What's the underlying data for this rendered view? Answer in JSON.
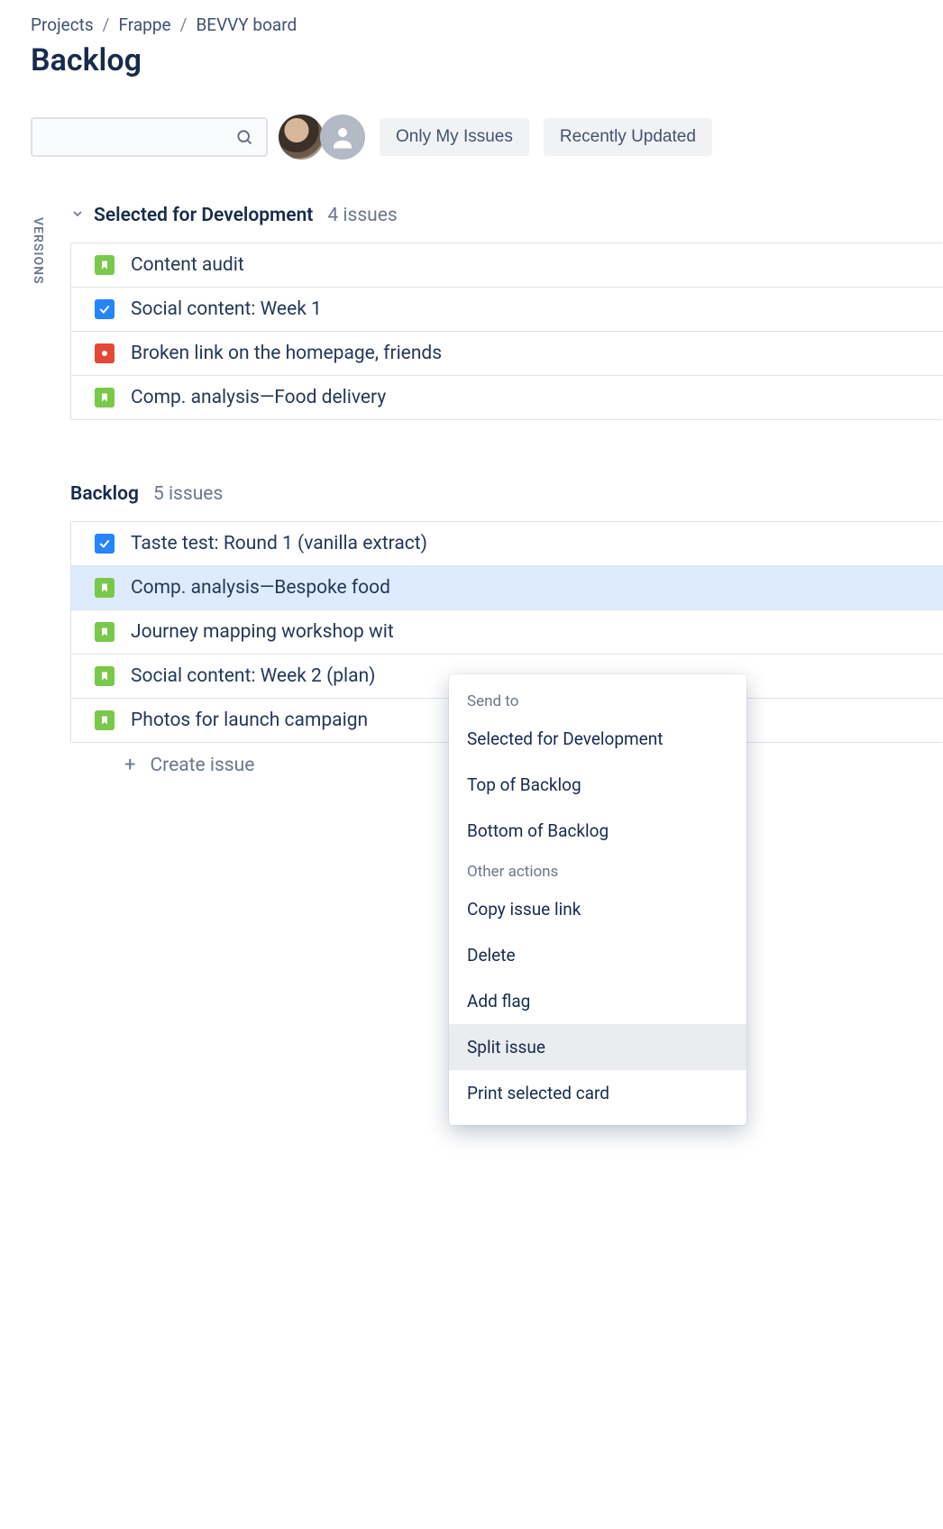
{
  "breadcrumb": {
    "item0": "Projects",
    "item1": "Frappe",
    "item2": "BEVVY board"
  },
  "page_title": "Backlog",
  "toolbar": {
    "only_my_issues": "Only My Issues",
    "recently_updated": "Recently Updated"
  },
  "versions_label": "VERSIONS",
  "sections": {
    "selected": {
      "title": "Selected for Development",
      "count_label": "4 issues"
    },
    "backlog": {
      "title": "Backlog",
      "count_label": "5 issues"
    }
  },
  "selected_issues": [
    {
      "type": "story",
      "title": "Content audit"
    },
    {
      "type": "task",
      "title": "Social content: Week 1"
    },
    {
      "type": "bug",
      "title": "Broken link on the homepage, friends"
    },
    {
      "type": "story",
      "title": "Comp. analysis—Food delivery"
    }
  ],
  "backlog_issues": [
    {
      "type": "task",
      "title": "Taste test: Round 1 (vanilla extract)",
      "selected": false
    },
    {
      "type": "story",
      "title": "Comp. analysis—Bespoke food",
      "selected": true
    },
    {
      "type": "story",
      "title": "Journey mapping workshop wit",
      "selected": false
    },
    {
      "type": "story",
      "title": "Social content: Week 2 (plan)",
      "selected": false
    },
    {
      "type": "story",
      "title": "Photos for launch campaign",
      "selected": false
    }
  ],
  "create_issue_label": "Create issue",
  "context_menu": {
    "send_to_label": "Send to",
    "send_to": {
      "selected_dev": "Selected for Development",
      "top_backlog": "Top of Backlog",
      "bottom_backlog": "Bottom of Backlog"
    },
    "other_label": "Other actions",
    "other": {
      "copy_link": "Copy issue link",
      "delete": "Delete",
      "add_flag": "Add flag",
      "split_issue": "Split issue",
      "print": "Print selected card"
    }
  }
}
